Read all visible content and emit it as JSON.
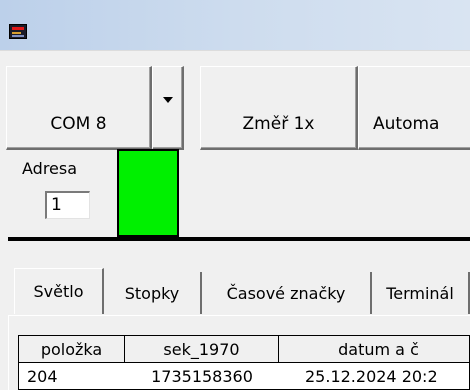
{
  "titlebar": {
    "icon": "app-icon"
  },
  "toolbar": {
    "com_label": "COM 8",
    "dropdown_icon": "triangle-down",
    "measure_label": "Změř 1x",
    "auto_label": "Automa"
  },
  "address": {
    "label": "Adresa",
    "value": "1",
    "indicator_color": "#00f000"
  },
  "tabs": [
    {
      "label": "Světlo"
    },
    {
      "label": "Stopky"
    },
    {
      "label": "Časové značky"
    },
    {
      "label": "Terminál"
    }
  ],
  "table": {
    "columns": [
      "položka",
      "sek_1970",
      "datum a č"
    ],
    "rows": [
      [
        "204",
        "1735158360",
        "25.12.2024 20:2"
      ]
    ]
  }
}
